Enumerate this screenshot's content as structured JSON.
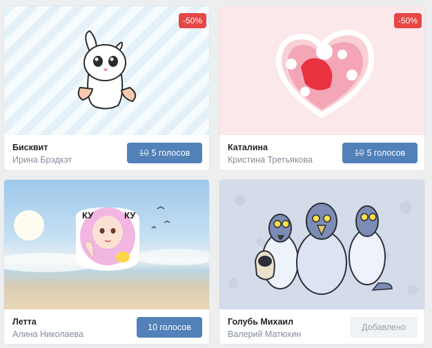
{
  "cards": [
    {
      "name": "Бисквит",
      "author": "Ирина Брэдкэт",
      "badge": "-50%",
      "old_price": "10",
      "price": "5 голосов"
    },
    {
      "name": "Каталина",
      "author": "Кристина Третьякова",
      "badge": "-50%",
      "old_price": "10",
      "price": "5 голосов"
    },
    {
      "name": "Летта",
      "author": "Алина Николаева",
      "price": "10 голосов",
      "sticker_text_left": "КУ",
      "sticker_text_right": "КУ"
    },
    {
      "name": "Голубь Михаил",
      "author": "Валерий Матюхин",
      "status": "Добавлено"
    }
  ],
  "colors": {
    "accent": "#5181b8",
    "badge": "#e64646",
    "added_bg": "#f0f2f5"
  }
}
